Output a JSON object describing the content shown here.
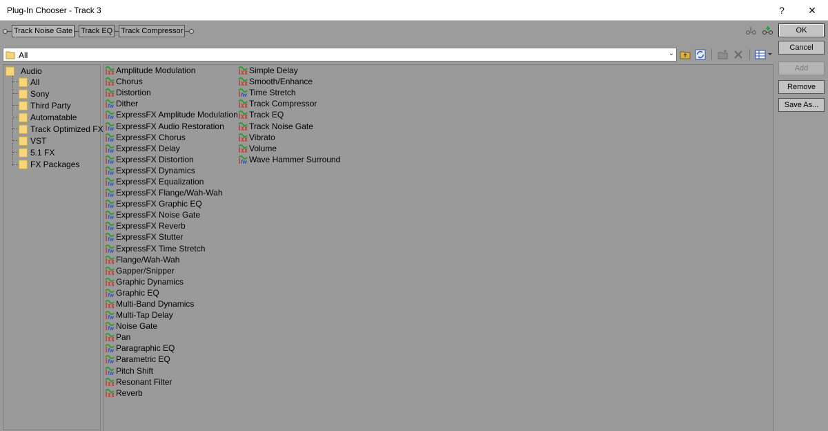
{
  "window": {
    "title": "Plug-In Chooser - Track 3",
    "help": "?",
    "close": "✕"
  },
  "chain": {
    "plugins": [
      "Track Noise Gate",
      "Track EQ",
      "Track Compressor"
    ]
  },
  "buttons": {
    "ok": "OK",
    "cancel": "Cancel",
    "add": "Add",
    "remove": "Remove",
    "save_as": "Save As..."
  },
  "combo": {
    "value": "All",
    "arrow": "⌄"
  },
  "tree": {
    "root": "Audio",
    "children": [
      "All",
      "Sony",
      "Third Party",
      "Automatable",
      "Track Optimized FX",
      "VST",
      "5.1 FX",
      "FX Packages"
    ]
  },
  "plugins": {
    "column1": [
      {
        "name": "Amplitude Modulation",
        "icon": "dx-icon"
      },
      {
        "name": "Chorus",
        "icon": "dx-icon"
      },
      {
        "name": "Distortion",
        "icon": "dx-icon"
      },
      {
        "name": "Dither",
        "icon": "dx-blue-icon"
      },
      {
        "name": "ExpressFX Amplitude Modulation",
        "icon": "dx-blue-icon"
      },
      {
        "name": "ExpressFX Audio Restoration",
        "icon": "dx-blue-icon"
      },
      {
        "name": "ExpressFX Chorus",
        "icon": "dx-blue-icon"
      },
      {
        "name": "ExpressFX Delay",
        "icon": "dx-blue-icon"
      },
      {
        "name": "ExpressFX Distortion",
        "icon": "dx-blue-icon"
      },
      {
        "name": "ExpressFX Dynamics",
        "icon": "dx-blue-icon"
      },
      {
        "name": "ExpressFX Equalization",
        "icon": "dx-blue-icon"
      },
      {
        "name": "ExpressFX Flange/Wah-Wah",
        "icon": "dx-blue-icon"
      },
      {
        "name": "ExpressFX Graphic EQ",
        "icon": "dx-blue-icon"
      },
      {
        "name": "ExpressFX Noise Gate",
        "icon": "dx-blue-icon"
      },
      {
        "name": "ExpressFX Reverb",
        "icon": "dx-blue-icon"
      },
      {
        "name": "ExpressFX Stutter",
        "icon": "dx-blue-icon"
      },
      {
        "name": "ExpressFX Time Stretch",
        "icon": "dx-blue-icon"
      },
      {
        "name": "Flange/Wah-Wah",
        "icon": "dx-icon"
      },
      {
        "name": "Gapper/Snipper",
        "icon": "dx-icon"
      },
      {
        "name": "Graphic Dynamics",
        "icon": "dx-icon"
      },
      {
        "name": "Graphic EQ",
        "icon": "dx-blue-icon"
      },
      {
        "name": "Multi-Band Dynamics",
        "icon": "dx-icon"
      },
      {
        "name": "Multi-Tap Delay",
        "icon": "dx-blue-icon"
      },
      {
        "name": "Noise Gate",
        "icon": "dx-blue-icon"
      },
      {
        "name": "Pan",
        "icon": "dx-icon"
      },
      {
        "name": "Paragraphic EQ",
        "icon": "dx-blue-icon"
      },
      {
        "name": "Parametric EQ",
        "icon": "dx-blue-icon"
      },
      {
        "name": "Pitch Shift",
        "icon": "dx-blue-icon"
      },
      {
        "name": "Resonant Filter",
        "icon": "dx-icon"
      },
      {
        "name": "Reverb",
        "icon": "dx-icon"
      }
    ],
    "column2": [
      {
        "name": "Simple Delay",
        "icon": "dx-icon"
      },
      {
        "name": "Smooth/Enhance",
        "icon": "dx-icon"
      },
      {
        "name": "Time Stretch",
        "icon": "dx-blue-icon"
      },
      {
        "name": "Track Compressor",
        "icon": "dx-icon"
      },
      {
        "name": "Track EQ",
        "icon": "dx-icon"
      },
      {
        "name": "Track Noise Gate",
        "icon": "dx-icon"
      },
      {
        "name": "Vibrato",
        "icon": "dx-icon"
      },
      {
        "name": "Volume",
        "icon": "dx-icon"
      },
      {
        "name": "Wave Hammer Surround",
        "icon": "dx-blue-icon"
      }
    ]
  },
  "colors": {
    "background": "#9c9c9c",
    "folder": "#f5d67a",
    "icon_green": "#2e9a3a",
    "icon_red": "#c0392b",
    "icon_blue": "#2a4fb5"
  }
}
